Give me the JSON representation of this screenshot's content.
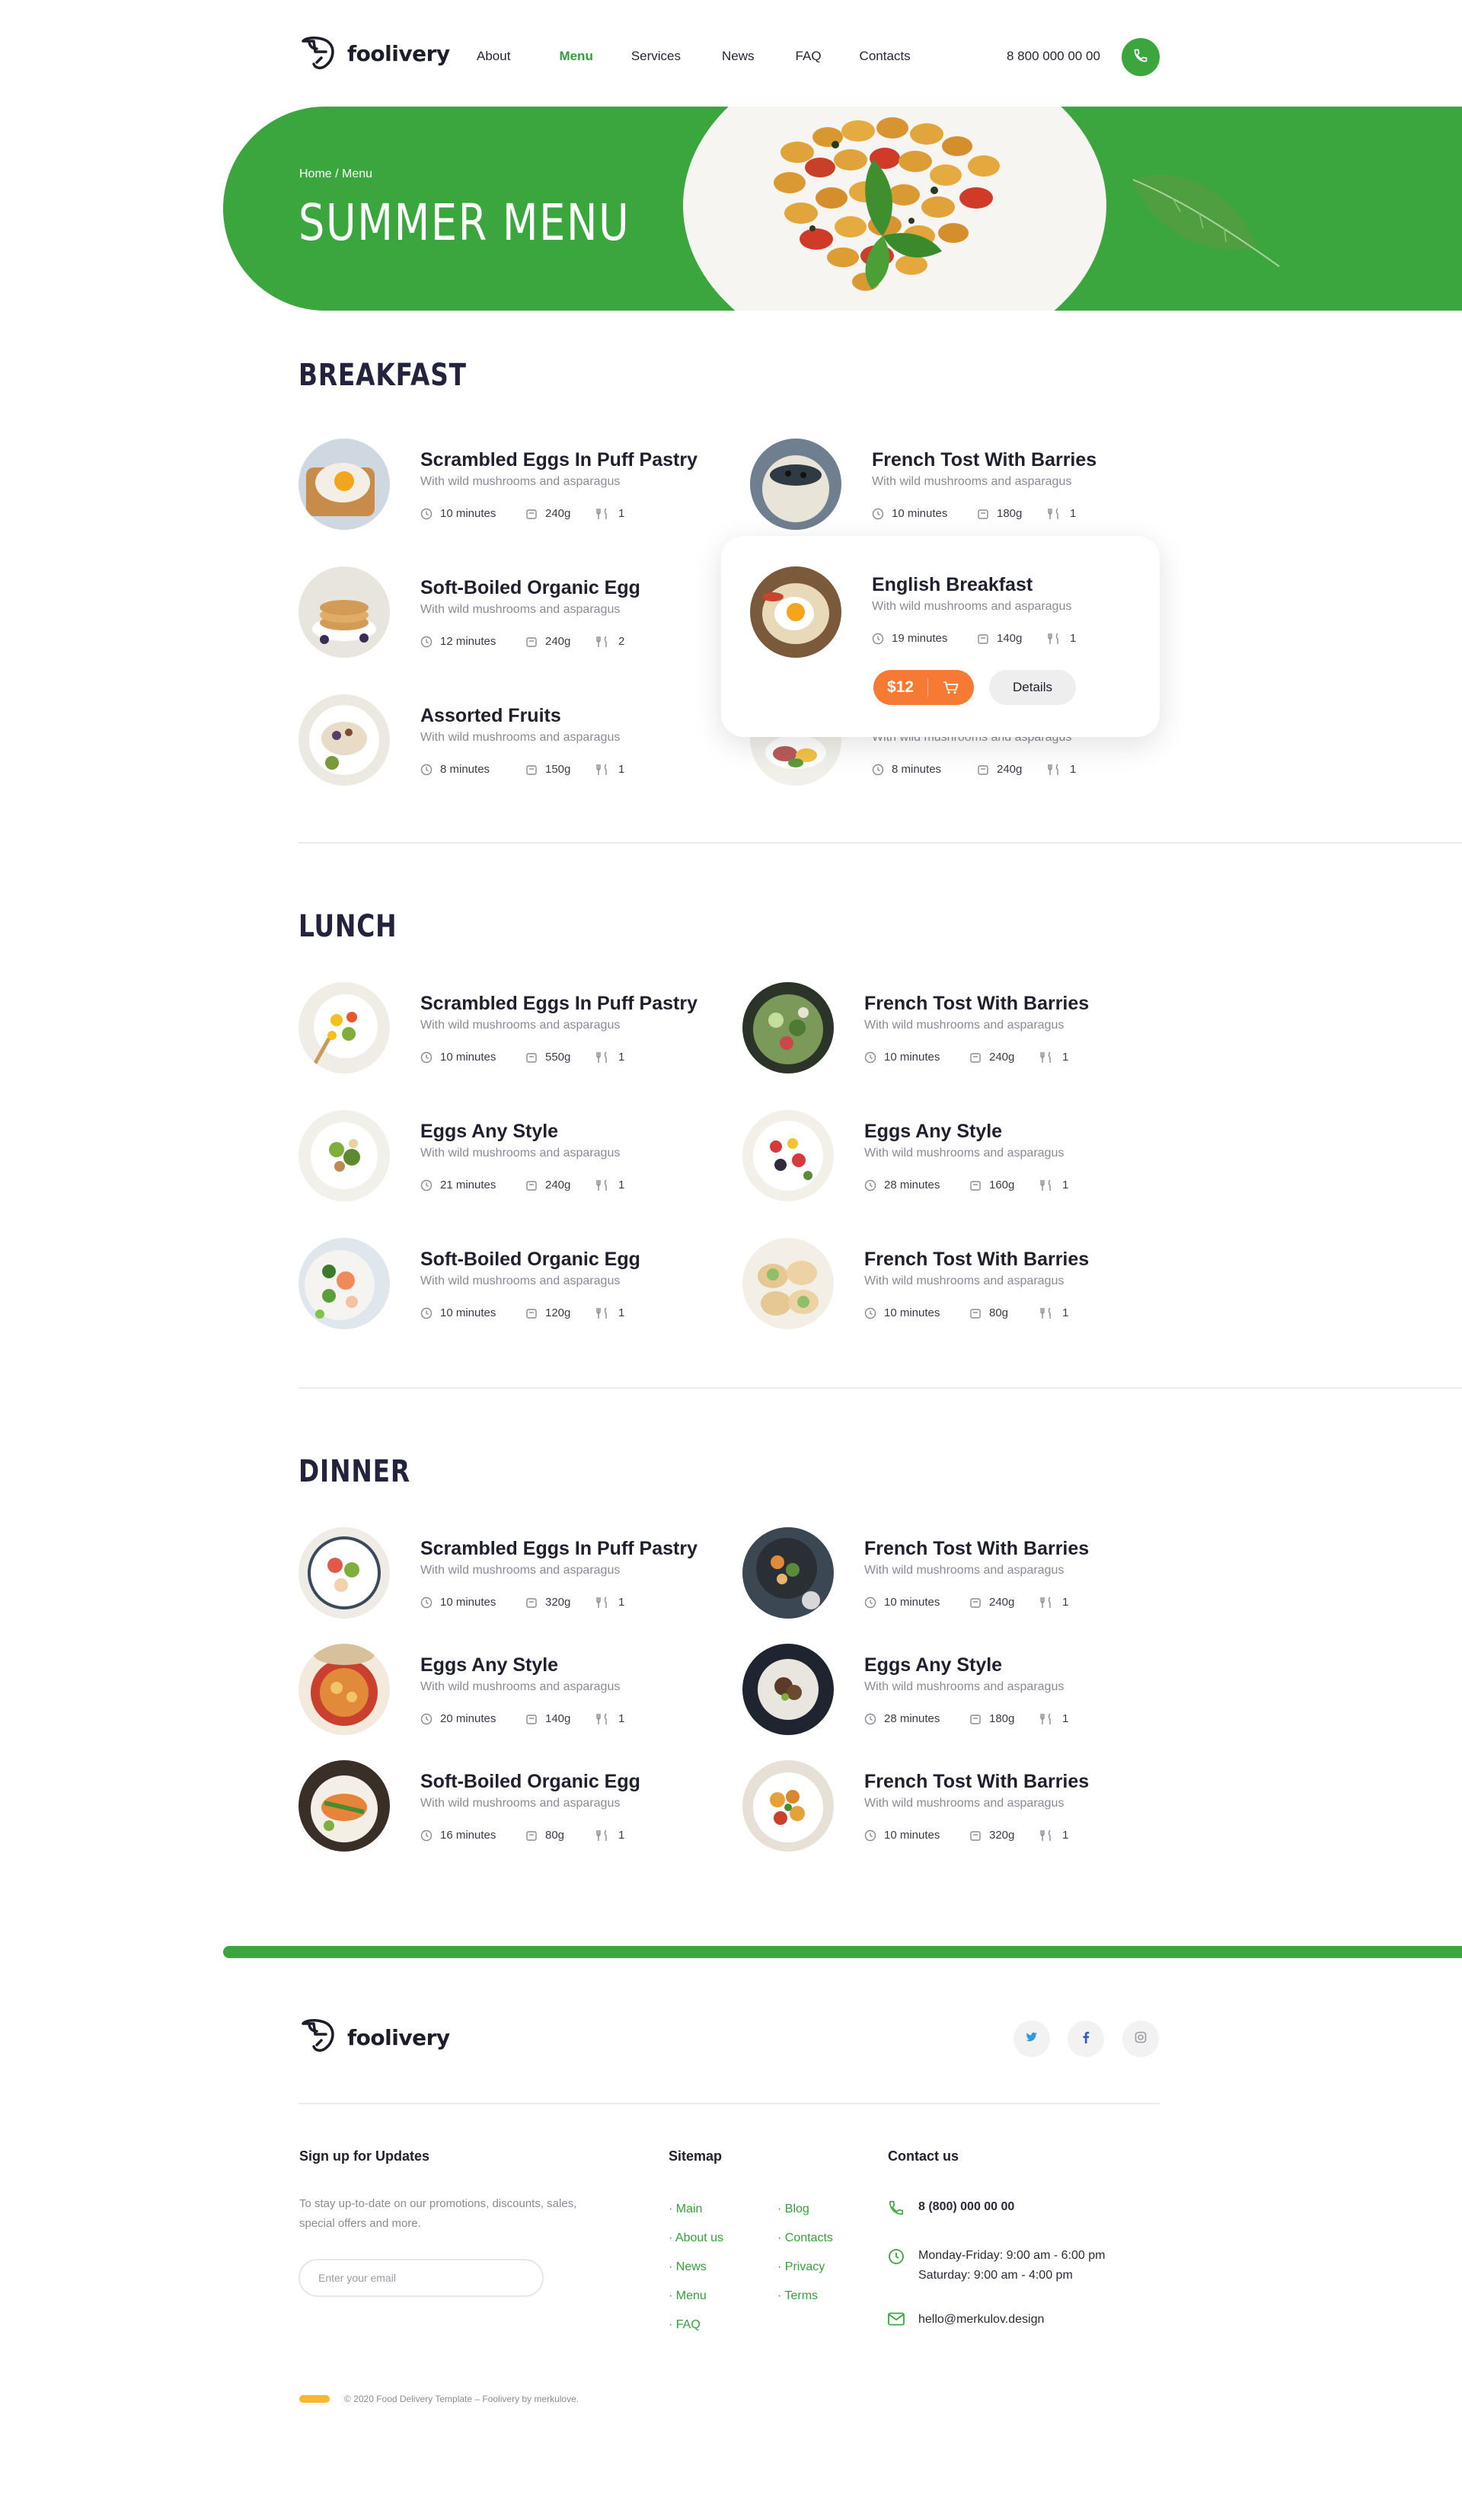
{
  "header": {
    "brand": "foolivery",
    "nav": [
      "About",
      "Menu",
      "Services",
      "News",
      "FAQ",
      "Contacts"
    ],
    "active_nav": "Menu",
    "phone": "8 800 000 00 00"
  },
  "hero": {
    "breadcrumb_home": "Home",
    "breadcrumb_sep": " / ",
    "breadcrumb_current": "Menu",
    "title": "SUMMER MENU"
  },
  "sections": {
    "breakfast": {
      "title": "BREAKFAST",
      "items": [
        {
          "name": "Scrambled Eggs In Puff Pastry",
          "desc": "With wild mushrooms and asparagus",
          "time": "10 minutes",
          "weight": "240g",
          "servings": "1"
        },
        {
          "name": "French Tost With Barries",
          "desc": "With wild mushrooms and asparagus",
          "time": "10 minutes",
          "weight": "180g",
          "servings": "1"
        },
        {
          "name": "Soft-Boiled Organic Egg",
          "desc": "With wild mushrooms and asparagus",
          "time": "12 minutes",
          "weight": "240g",
          "servings": "2"
        },
        {
          "name": "Assorted Fruits",
          "desc": "With wild mushrooms and asparagus",
          "time": "8 minutes",
          "weight": "150g",
          "servings": "1"
        },
        {
          "name": "",
          "desc": "With wild mushrooms and asparagus",
          "time": "8 minutes",
          "weight": "240g",
          "servings": "1"
        }
      ],
      "popup": {
        "name": "English Breakfast",
        "desc": "With wild mushrooms and asparagus",
        "time": "19 minutes",
        "weight": "140g",
        "servings": "1",
        "price": "$12",
        "details": "Details"
      }
    },
    "lunch": {
      "title": "LUNCH",
      "items": [
        {
          "name": "Scrambled Eggs In Puff Pastry",
          "desc": "With wild mushrooms and asparagus",
          "time": "10 minutes",
          "weight": "550g",
          "servings": "1"
        },
        {
          "name": "French Tost With Barries",
          "desc": "With wild mushrooms and asparagus",
          "time": "10 minutes",
          "weight": "240g",
          "servings": "1"
        },
        {
          "name": "Eggs Any Style",
          "desc": "With wild mushrooms and asparagus",
          "time": "21 minutes",
          "weight": "240g",
          "servings": "1"
        },
        {
          "name": "Eggs Any Style",
          "desc": "With wild mushrooms and asparagus",
          "time": "28 minutes",
          "weight": "160g",
          "servings": "1"
        },
        {
          "name": "Soft-Boiled Organic Egg",
          "desc": "With wild mushrooms and asparagus",
          "time": "10 minutes",
          "weight": "120g",
          "servings": "1"
        },
        {
          "name": "French Tost With Barries",
          "desc": "With wild mushrooms and asparagus",
          "time": "10 minutes",
          "weight": "80g",
          "servings": "1"
        }
      ]
    },
    "dinner": {
      "title": "DINNER",
      "items": [
        {
          "name": "Scrambled Eggs In Puff Pastry",
          "desc": "With wild mushrooms and asparagus",
          "time": "10 minutes",
          "weight": "320g",
          "servings": "1"
        },
        {
          "name": "French Tost With Barries",
          "desc": "With wild mushrooms and asparagus",
          "time": "10 minutes",
          "weight": "240g",
          "servings": "1"
        },
        {
          "name": "Eggs Any Style",
          "desc": "With wild mushrooms and asparagus",
          "time": "20 minutes",
          "weight": "140g",
          "servings": "1"
        },
        {
          "name": "Eggs Any Style",
          "desc": "With wild mushrooms and asparagus",
          "time": "28 minutes",
          "weight": "180g",
          "servings": "1"
        },
        {
          "name": "Soft-Boiled Organic Egg",
          "desc": "With wild mushrooms and asparagus",
          "time": "16 minutes",
          "weight": "80g",
          "servings": "1"
        },
        {
          "name": "French Tost With Barries",
          "desc": "With wild mushrooms and asparagus",
          "time": "10 minutes",
          "weight": "320g",
          "servings": "1"
        }
      ]
    }
  },
  "footer": {
    "brand": "foolivery",
    "social": [
      "twitter-icon",
      "facebook-icon",
      "instagram-icon"
    ],
    "signup_title": "Sign up for Updates",
    "signup_text_1": "To stay up-to-date on our promotions, discounts, sales,",
    "signup_text_2": "special offers and more.",
    "email_placeholder": "Enter your email",
    "sitemap_title": "Sitemap",
    "sitemap_col1": [
      "· Main",
      "· About us",
      "· News",
      "· Menu",
      "· FAQ"
    ],
    "sitemap_col2": [
      "· Blog",
      "· Contacts",
      "· Privacy",
      "· Terms"
    ],
    "contact_title": "Contact us",
    "contact_phone": "8 (800) 000 00 00",
    "hours_1": "Monday-Friday: 9:00 am - 6:00 pm",
    "hours_2": "Saturday: 9:00 am - 4:00 pm",
    "email": "hello@merkulov.design",
    "copyright": "© 2020 Food Delivery Template – Foolivery by merkulove."
  },
  "colors": {
    "brand_green": "#3ba63d",
    "accent_orange": "#f77a34",
    "footer_accent": "#f7b731",
    "heading": "#24233d"
  }
}
